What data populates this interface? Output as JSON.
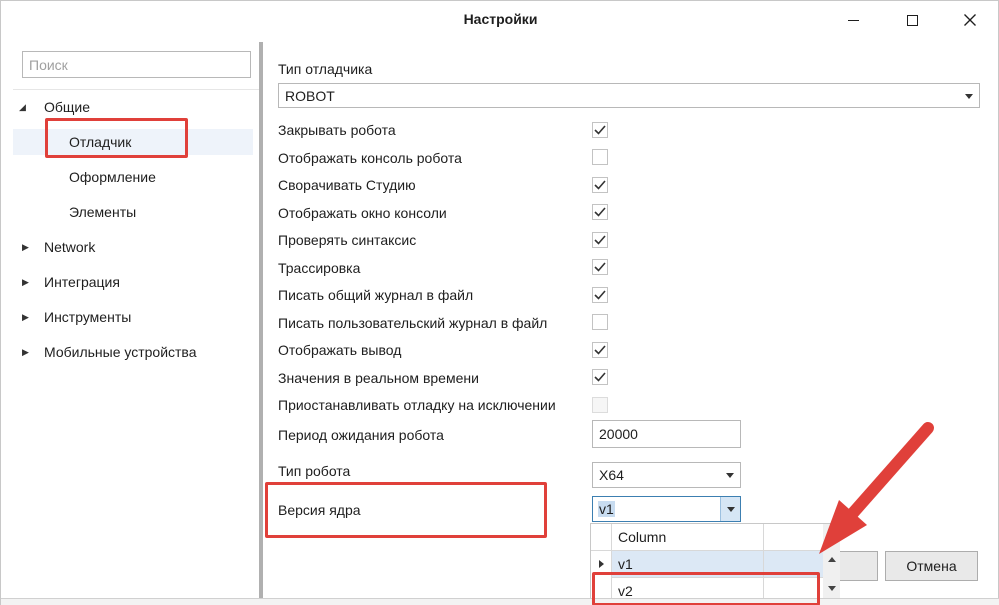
{
  "window": {
    "title": "Настройки"
  },
  "sidebar": {
    "search_placeholder": "Поиск",
    "items": [
      {
        "label": "Общие",
        "expanded": true
      },
      {
        "label": "Отладчик",
        "selected": true
      },
      {
        "label": "Оформление"
      },
      {
        "label": "Элементы"
      },
      {
        "label": "Network",
        "expanded": false
      },
      {
        "label": "Интеграция",
        "expanded": false
      },
      {
        "label": "Инструменты",
        "expanded": false
      },
      {
        "label": "Мобильные устройства",
        "expanded": false
      }
    ]
  },
  "settings": {
    "debugger_type_label": "Тип отладчика",
    "debugger_type_value": "ROBOT",
    "checkboxes": [
      {
        "label": "Закрывать робота",
        "checked": true
      },
      {
        "label": "Отображать консоль робота",
        "checked": false
      },
      {
        "label": "Сворачивать Студию",
        "checked": true
      },
      {
        "label": "Отображать окно консоли",
        "checked": true
      },
      {
        "label": "Проверять синтаксис",
        "checked": true
      },
      {
        "label": "Трассировка",
        "checked": true
      },
      {
        "label": "Писать общий журнал в файл",
        "checked": true
      },
      {
        "label": "Писать пользовательский журнал в файл",
        "checked": false
      },
      {
        "label": "Отображать вывод",
        "checked": true
      },
      {
        "label": "Значения в реальном времени",
        "checked": true
      },
      {
        "label": "Приостанавливать отладку на исключении",
        "checked": false,
        "disabled": true
      }
    ],
    "robot_wait_label": "Период ожидания робота",
    "robot_wait_value": "20000",
    "robot_type_label": "Тип робота",
    "robot_type_value": "X64",
    "core_version_label": "Версия ядра",
    "core_version_value": "v1"
  },
  "dropdown": {
    "column_header": "Column",
    "options": [
      "v1",
      "v2"
    ],
    "selected": "v1"
  },
  "buttons": {
    "ok_label": "",
    "cancel_label": "Отмена"
  },
  "colors": {
    "annotation": "#e0403a",
    "selection": "#c8dcf0"
  }
}
